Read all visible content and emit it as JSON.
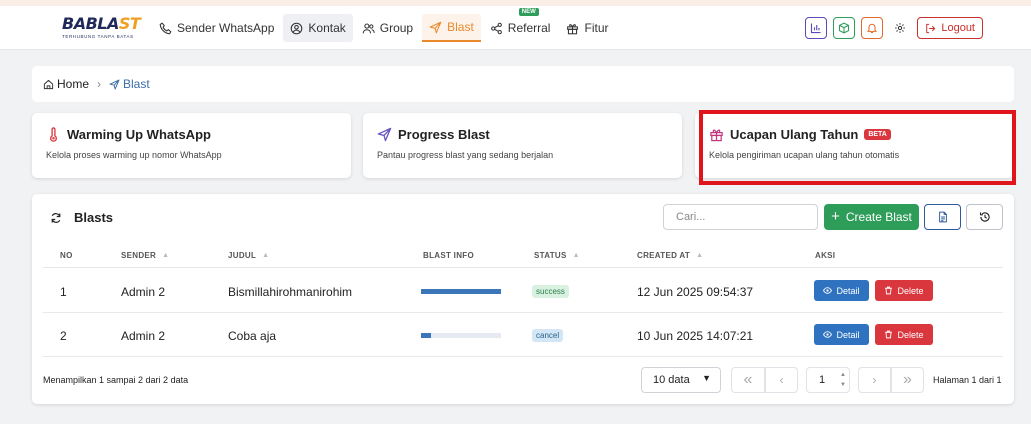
{
  "navbar": {
    "logo_text_1": "BABLA",
    "logo_text_2": "ST",
    "logo_tagline": "TERHUBUNG TANPA BATAS",
    "items": [
      {
        "label": "Sender WhatsApp",
        "icon": "phone-icon"
      },
      {
        "label": "Kontak",
        "icon": "contact-icon"
      },
      {
        "label": "Group",
        "icon": "users-icon"
      },
      {
        "label": "Blast",
        "icon": "send-icon"
      },
      {
        "label": "Referral",
        "icon": "share-icon",
        "badge": "NEW"
      },
      {
        "label": "Fitur",
        "icon": "gift-icon"
      }
    ],
    "logout_label": "Logout",
    "accent_color": "#e8892c"
  },
  "breadcrumb": {
    "home": "Home",
    "current": "Blast"
  },
  "cards": [
    {
      "title": "Warming Up WhatsApp",
      "subtitle": "Kelola proses warming up nomor WhatsApp",
      "icon": "thermometer-icon"
    },
    {
      "title": "Progress Blast",
      "subtitle": "Pantau progress blast yang sedang berjalan",
      "icon": "send-icon"
    },
    {
      "title": "Ucapan Ulang Tahun",
      "badge": "BETA",
      "subtitle": "Kelola pengiriman ucapan ulang tahun otomatis",
      "icon": "gift-icon"
    }
  ],
  "blasts": {
    "title": "Blasts",
    "search_placeholder": "Cari...",
    "create_label": "Create Blast",
    "columns": [
      "NO",
      "SENDER",
      "JUDUL",
      "BLAST INFO",
      "STATUS",
      "CREATED AT",
      "AKSI"
    ],
    "rows": [
      {
        "no": "1",
        "sender": "Admin 2",
        "judul": "Bismillahirohmanirohim",
        "progress": 1.0,
        "status": "success",
        "created_at": "12 Jun 2025 09:54:37"
      },
      {
        "no": "2",
        "sender": "Admin 2",
        "judul": "Coba aja",
        "progress": 0.12,
        "status": "cancel",
        "created_at": "10 Jun 2025 14:07:21"
      }
    ],
    "detail_label": "Detail",
    "delete_label": "Delete",
    "info": "Menampilkan 1 sampai 2 dari 2 data",
    "per_page": "10 data",
    "page_value": "1",
    "page_label": "Halaman 1 dari 1"
  }
}
